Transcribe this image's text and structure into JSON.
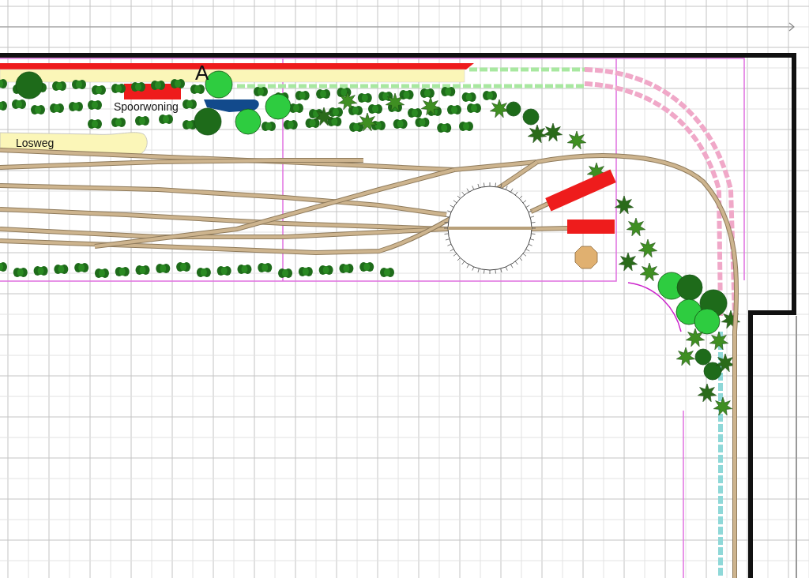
{
  "canvas": {
    "labels": [
      {
        "text": "A",
        "kind": "marker"
      },
      {
        "text": "Spoorwoning",
        "kind": "building"
      },
      {
        "text": "Losweg",
        "kind": "road"
      }
    ]
  }
}
